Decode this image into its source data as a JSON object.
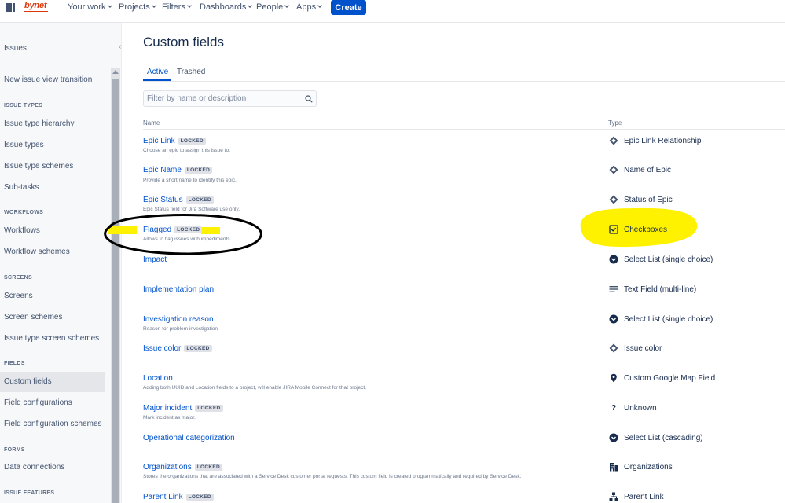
{
  "topnav": {
    "logo": "bynet",
    "items": [
      "Your work",
      "Projects",
      "Filters",
      "Dashboards",
      "People",
      "Apps"
    ],
    "create_label": "Create"
  },
  "sidebar": {
    "items": {
      "issues": "Issues",
      "new_issue_view": "New issue view transition",
      "h_issue_types": "ISSUE TYPES",
      "issue_type_hierarchy": "Issue type hierarchy",
      "issue_types": "Issue types",
      "issue_type_schemes": "Issue type schemes",
      "sub_tasks": "Sub-tasks",
      "h_workflows": "WORKFLOWS",
      "workflows": "Workflows",
      "workflow_schemes": "Workflow schemes",
      "h_screens": "SCREENS",
      "screens": "Screens",
      "screen_schemes": "Screen schemes",
      "issue_type_screen_schemes": "Issue type screen schemes",
      "h_fields": "FIELDS",
      "custom_fields": "Custom fields",
      "field_configurations": "Field configurations",
      "field_configuration_schemes": "Field configuration schemes",
      "h_forms": "FORMS",
      "data_connections": "Data connections",
      "h_issue_features": "ISSUE FEATURES"
    }
  },
  "main": {
    "title": "Custom fields",
    "tabs": [
      "Active",
      "Trashed"
    ],
    "filter_placeholder": "Filter by name or description",
    "col_name": "Name",
    "col_type": "Type",
    "locked_label": "LOCKED",
    "fields": [
      {
        "name": "Epic Link",
        "locked": true,
        "desc": "Choose an epic to assign this issue to.",
        "type": "Epic Link Relationship",
        "icon": "diamond-icon"
      },
      {
        "name": "Epic Name",
        "locked": true,
        "desc": "Provide a short name to identify this epic.",
        "type": "Name of Epic",
        "icon": "diamond-icon"
      },
      {
        "name": "Epic Status",
        "locked": true,
        "desc": "Epic Status field for Jira Software use only.",
        "type": "Status of Epic",
        "icon": "diamond-icon"
      },
      {
        "name": "Flagged",
        "locked": true,
        "desc": "Allows to flag issues with impediments.",
        "type": "Checkboxes",
        "icon": "checkbox-icon"
      },
      {
        "name": "Impact",
        "locked": false,
        "desc": "",
        "type": "Select List (single choice)",
        "icon": "chevron-circle-icon"
      },
      {
        "name": "Implementation plan",
        "locked": false,
        "desc": "",
        "type": "Text Field (multi-line)",
        "icon": "text-lines-icon"
      },
      {
        "name": "Investigation reason",
        "locked": false,
        "desc": "Reason for problem investigation",
        "type": "Select List (single choice)",
        "icon": "chevron-circle-icon"
      },
      {
        "name": "Issue color",
        "locked": true,
        "desc": "",
        "type": "Issue color",
        "icon": "diamond-icon"
      },
      {
        "name": "Location",
        "locked": false,
        "desc": "Adding both UUID and Location fields to a project, will enable JIRA Mobile Connect for that project.",
        "type": "Custom Google Map Field",
        "icon": "map-pin-icon"
      },
      {
        "name": "Major incident",
        "locked": true,
        "desc": "Mark incident as major.",
        "type": "Unknown",
        "icon": "question-icon"
      },
      {
        "name": "Operational categorization",
        "locked": false,
        "desc": "",
        "type": "Select List (cascading)",
        "icon": "chevron-circle-icon"
      },
      {
        "name": "Organizations",
        "locked": true,
        "desc": "Stores the organizations that are associated with a Service Desk customer portal requests. This custom field is created programmatically and required by Service Desk.",
        "type": "Organizations",
        "icon": "building-icon"
      },
      {
        "name": "Parent Link",
        "locked": true,
        "desc": "",
        "type": "Parent Link",
        "icon": "hierarchy-icon"
      }
    ]
  },
  "colors": {
    "brand_blue": "#0052cc",
    "logo_red": "#de350b",
    "highlight_yellow": "#fff200",
    "annotation_black": "#000000"
  }
}
